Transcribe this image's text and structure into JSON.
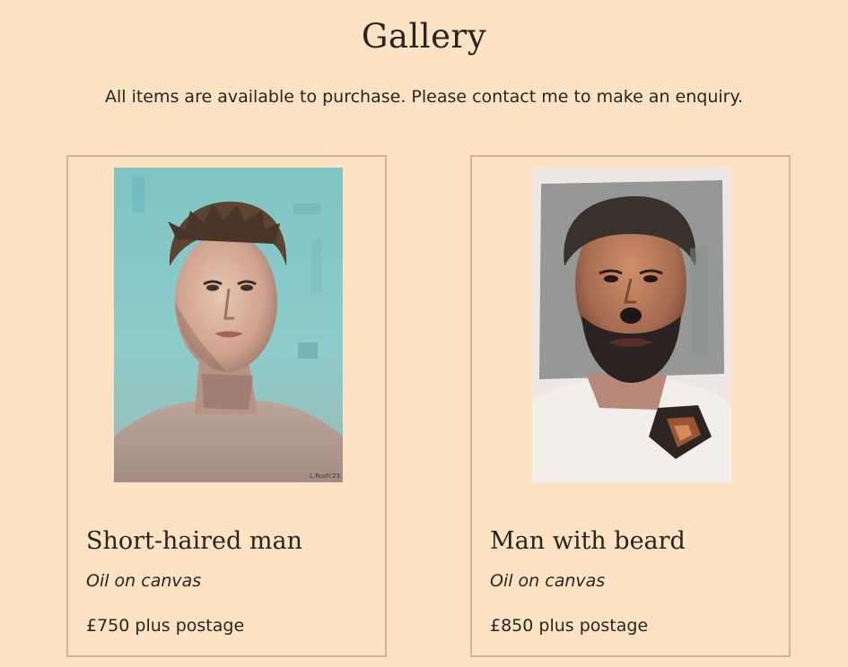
{
  "page": {
    "title": "Gallery",
    "intro": "All items are available to purchase. Please contact me to make an enquiry."
  },
  "gallery": {
    "items": [
      {
        "title": "Short-haired man",
        "medium": "Oil on canvas",
        "price": "£750 plus postage",
        "signature": "L.Rush'23"
      },
      {
        "title": "Man with beard",
        "medium": "Oil on canvas",
        "price": "£850 plus postage"
      }
    ]
  },
  "colors": {
    "page_background": "#fde3c3",
    "card_border": "#d1b295",
    "text": "#2a2320"
  }
}
